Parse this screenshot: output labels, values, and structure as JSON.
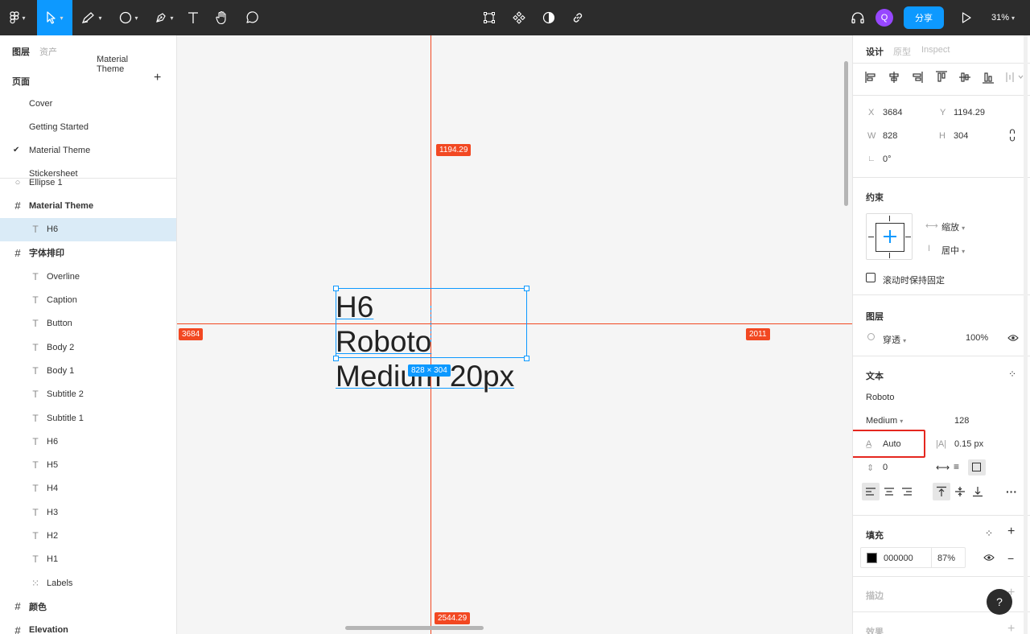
{
  "toolbar": {
    "share_label": "分享",
    "avatar_initial": "Q",
    "zoom": "31%"
  },
  "left_panel": {
    "tabs": {
      "layers": "图层",
      "assets": "资产",
      "theme": "Material Theme"
    },
    "pages_title": "页面",
    "pages": [
      {
        "name": "Cover"
      },
      {
        "name": "Getting Started"
      },
      {
        "name": "Material Theme",
        "current": true
      },
      {
        "name": "Stickersheet"
      }
    ],
    "layers": [
      {
        "name": "Ellipse 1",
        "icon": "ellipse-icon"
      },
      {
        "name": "Material Theme",
        "icon": "frame-icon",
        "bold": true
      },
      {
        "name": "H6",
        "icon": "text-icon",
        "selected": true
      },
      {
        "name": "字体排印",
        "icon": "frame-icon",
        "bold": true
      },
      {
        "name": "Overline",
        "icon": "text-icon"
      },
      {
        "name": "Caption",
        "icon": "text-icon"
      },
      {
        "name": "Button",
        "icon": "text-icon"
      },
      {
        "name": "Body 2",
        "icon": "text-icon"
      },
      {
        "name": "Body 1",
        "icon": "text-icon"
      },
      {
        "name": "Subtitle 2",
        "icon": "text-icon"
      },
      {
        "name": "Subtitle 1",
        "icon": "text-icon"
      },
      {
        "name": "H6",
        "icon": "text-icon"
      },
      {
        "name": "H5",
        "icon": "text-icon"
      },
      {
        "name": "H4",
        "icon": "text-icon"
      },
      {
        "name": "H3",
        "icon": "text-icon"
      },
      {
        "name": "H2",
        "icon": "text-icon"
      },
      {
        "name": "H1",
        "icon": "text-icon"
      },
      {
        "name": "Labels",
        "icon": "group-icon"
      },
      {
        "name": "颜色",
        "icon": "frame-icon",
        "bold": true
      },
      {
        "name": "Elevation",
        "icon": "frame-icon",
        "bold": true
      }
    ]
  },
  "canvas": {
    "text_lines": [
      "H6",
      "Roboto",
      "Medium 20px"
    ],
    "measure_top": "1194.29",
    "measure_left": "3684",
    "measure_right": "2011",
    "measure_bottom": "2544.29",
    "dimensions": "828 × 304"
  },
  "right_panel": {
    "tabs": {
      "design": "设计",
      "prototype": "原型",
      "inspect": "Inspect"
    },
    "x_label": "X",
    "x_value": "3684",
    "y_label": "Y",
    "y_value": "1194.29",
    "w_label": "W",
    "w_value": "828",
    "h_label": "H",
    "h_value": "304",
    "rotation": "0°",
    "constraints_title": "约束",
    "constraint_h": "缩放",
    "constraint_v": "居中",
    "fix_scroll": "滚动时保持固定",
    "layer_title": "图层",
    "blend_mode": "穿透",
    "opacity": "100%",
    "text_title": "文本",
    "font_family": "Roboto",
    "font_weight": "Medium",
    "font_size": "128",
    "line_height": "Auto",
    "letter_spacing": "0.15 px",
    "paragraph_spacing": "0",
    "fill_title": "填充",
    "fill_hex": "000000",
    "fill_opacity": "87%",
    "stroke_title": "描边",
    "effects_title": "效果",
    "help": "?"
  },
  "colors": {
    "accent": "#0d99ff",
    "measure": "#f24822",
    "toolbar_bg": "#2c2c2c",
    "highlight": "#e5271f",
    "selected_layer": "#daebf7"
  }
}
